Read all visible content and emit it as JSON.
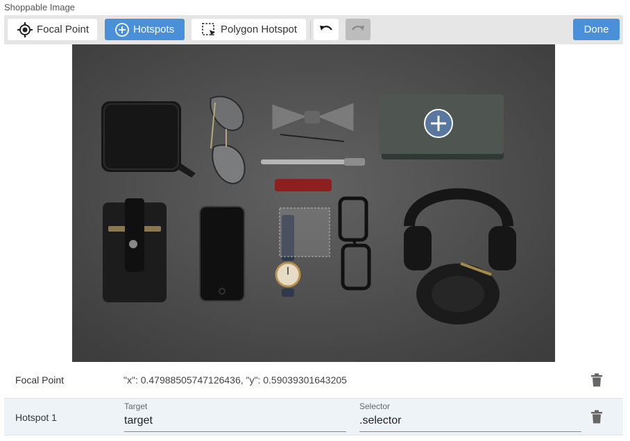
{
  "app": {
    "title": "Shoppable Image"
  },
  "toolbar": {
    "focal_point_label": "Focal Point",
    "hotspots_label": "Hotspots",
    "polygon_hotspot_label": "Polygon Hotspot",
    "done_label": "Done",
    "active_tool": "Hotspots",
    "undo_icon": "undo-icon",
    "redo_icon": "redo-icon",
    "accent_color": "#4a90d9"
  },
  "image": {
    "description_icon": "flat-lay-accessories-photo",
    "hotspot_marker_icon": "plus-circle-icon"
  },
  "focal_point": {
    "label": "Focal Point",
    "value": "\"x\": 0.47988505747126436, \"y\": 0.59039301643205"
  },
  "hotspots": [
    {
      "label": "Hotspot 1",
      "target_label": "Target",
      "target_value": "target",
      "selector_label": "Selector",
      "selector_value": ".selector"
    }
  ]
}
